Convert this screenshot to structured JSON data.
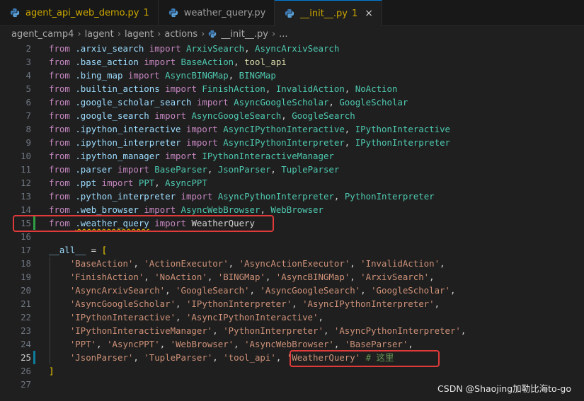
{
  "tabs": [
    {
      "label": "agent_api_web_demo.py",
      "badge": "1",
      "state": "warning"
    },
    {
      "label": "weather_query.py",
      "badge": "",
      "state": "normal"
    },
    {
      "label": "__init__.py",
      "badge": "1",
      "state": "active",
      "close": "×"
    }
  ],
  "breadcrumb": [
    "agent_camp4",
    "lagent",
    "lagent",
    "actions",
    "__init__.py",
    "..."
  ],
  "current_line": 25,
  "lines": [
    {
      "n": "2",
      "t": [
        [
          "kw",
          "from"
        ],
        [
          "pun",
          " "
        ],
        [
          "mod",
          ".arxiv_search"
        ],
        [
          "pun",
          " "
        ],
        [
          "kw",
          "import"
        ],
        [
          "pun",
          " "
        ],
        [
          "cls",
          "ArxivSearch"
        ],
        [
          "pun",
          ", "
        ],
        [
          "cls",
          "AsyncArxivSearch"
        ]
      ]
    },
    {
      "n": "3",
      "t": [
        [
          "kw",
          "from"
        ],
        [
          "pun",
          " "
        ],
        [
          "mod",
          ".base_action"
        ],
        [
          "pun",
          " "
        ],
        [
          "kw",
          "import"
        ],
        [
          "pun",
          " "
        ],
        [
          "cls",
          "BaseAction"
        ],
        [
          "pun",
          ", "
        ],
        [
          "fn",
          "tool_api"
        ]
      ]
    },
    {
      "n": "4",
      "t": [
        [
          "kw",
          "from"
        ],
        [
          "pun",
          " "
        ],
        [
          "mod",
          ".bing_map"
        ],
        [
          "pun",
          " "
        ],
        [
          "kw",
          "import"
        ],
        [
          "pun",
          " "
        ],
        [
          "cls",
          "AsyncBINGMap"
        ],
        [
          "pun",
          ", "
        ],
        [
          "cls",
          "BINGMap"
        ]
      ]
    },
    {
      "n": "5",
      "t": [
        [
          "kw",
          "from"
        ],
        [
          "pun",
          " "
        ],
        [
          "mod",
          ".builtin_actions"
        ],
        [
          "pun",
          " "
        ],
        [
          "kw",
          "import"
        ],
        [
          "pun",
          " "
        ],
        [
          "cls",
          "FinishAction"
        ],
        [
          "pun",
          ", "
        ],
        [
          "cls",
          "InvalidAction"
        ],
        [
          "pun",
          ", "
        ],
        [
          "cls",
          "NoAction"
        ]
      ]
    },
    {
      "n": "6",
      "t": [
        [
          "kw",
          "from"
        ],
        [
          "pun",
          " "
        ],
        [
          "mod",
          ".google_scholar_search"
        ],
        [
          "pun",
          " "
        ],
        [
          "kw",
          "import"
        ],
        [
          "pun",
          " "
        ],
        [
          "cls",
          "AsyncGoogleScholar"
        ],
        [
          "pun",
          ", "
        ],
        [
          "cls",
          "GoogleScholar"
        ]
      ]
    },
    {
      "n": "7",
      "t": [
        [
          "kw",
          "from"
        ],
        [
          "pun",
          " "
        ],
        [
          "mod",
          ".google_search"
        ],
        [
          "pun",
          " "
        ],
        [
          "kw",
          "import"
        ],
        [
          "pun",
          " "
        ],
        [
          "cls",
          "AsyncGoogleSearch"
        ],
        [
          "pun",
          ", "
        ],
        [
          "cls",
          "GoogleSearch"
        ]
      ]
    },
    {
      "n": "8",
      "t": [
        [
          "kw",
          "from"
        ],
        [
          "pun",
          " "
        ],
        [
          "mod",
          ".ipython_interactive"
        ],
        [
          "pun",
          " "
        ],
        [
          "kw",
          "import"
        ],
        [
          "pun",
          " "
        ],
        [
          "cls",
          "AsyncIPythonInteractive"
        ],
        [
          "pun",
          ", "
        ],
        [
          "cls",
          "IPythonInteractive"
        ]
      ]
    },
    {
      "n": "9",
      "t": [
        [
          "kw",
          "from"
        ],
        [
          "pun",
          " "
        ],
        [
          "mod",
          ".ipython_interpreter"
        ],
        [
          "pun",
          " "
        ],
        [
          "kw",
          "import"
        ],
        [
          "pun",
          " "
        ],
        [
          "cls",
          "AsyncIPythonInterpreter"
        ],
        [
          "pun",
          ", "
        ],
        [
          "cls",
          "IPythonInterpreter"
        ]
      ]
    },
    {
      "n": "10",
      "t": [
        [
          "kw",
          "from"
        ],
        [
          "pun",
          " "
        ],
        [
          "mod",
          ".ipython_manager"
        ],
        [
          "pun",
          " "
        ],
        [
          "kw",
          "import"
        ],
        [
          "pun",
          " "
        ],
        [
          "cls",
          "IPythonInteractiveManager"
        ]
      ]
    },
    {
      "n": "11",
      "t": [
        [
          "kw",
          "from"
        ],
        [
          "pun",
          " "
        ],
        [
          "mod",
          ".parser"
        ],
        [
          "pun",
          " "
        ],
        [
          "kw",
          "import"
        ],
        [
          "pun",
          " "
        ],
        [
          "cls",
          "BaseParser"
        ],
        [
          "pun",
          ", "
        ],
        [
          "cls",
          "JsonParser"
        ],
        [
          "pun",
          ", "
        ],
        [
          "cls",
          "TupleParser"
        ]
      ]
    },
    {
      "n": "12",
      "t": [
        [
          "kw",
          "from"
        ],
        [
          "pun",
          " "
        ],
        [
          "mod",
          ".ppt"
        ],
        [
          "pun",
          " "
        ],
        [
          "kw",
          "import"
        ],
        [
          "pun",
          " "
        ],
        [
          "cls",
          "PPT"
        ],
        [
          "pun",
          ", "
        ],
        [
          "cls",
          "AsyncPPT"
        ]
      ]
    },
    {
      "n": "13",
      "t": [
        [
          "kw",
          "from"
        ],
        [
          "pun",
          " "
        ],
        [
          "mod",
          ".python_interpreter"
        ],
        [
          "pun",
          " "
        ],
        [
          "kw",
          "import"
        ],
        [
          "pun",
          " "
        ],
        [
          "cls",
          "AsyncPythonInterpreter"
        ],
        [
          "pun",
          ", "
        ],
        [
          "cls",
          "PythonInterpreter"
        ]
      ]
    },
    {
      "n": "14",
      "t": [
        [
          "kw",
          "from"
        ],
        [
          "pun",
          " "
        ],
        [
          "mod",
          ".web_browser"
        ],
        [
          "pun",
          " "
        ],
        [
          "kw",
          "import"
        ],
        [
          "pun",
          " "
        ],
        [
          "cls",
          "AsyncWebBrowser"
        ],
        [
          "pun",
          ", "
        ],
        [
          "cls",
          "WebBrowser"
        ]
      ]
    },
    {
      "n": "15",
      "t": [
        [
          "kw",
          "from"
        ],
        [
          "pun",
          " "
        ],
        [
          "mod sq",
          ".weather_query"
        ],
        [
          "pun",
          " "
        ],
        [
          "kw",
          "import"
        ],
        [
          "pun",
          " "
        ],
        [
          "pun",
          "WeatherQuery"
        ]
      ]
    },
    {
      "n": "16",
      "t": []
    },
    {
      "n": "17",
      "t": [
        [
          "var",
          "__all__"
        ],
        [
          "pun",
          " = "
        ],
        [
          "br",
          "["
        ]
      ]
    },
    {
      "n": "18",
      "t": [
        [
          "pun",
          "    "
        ],
        [
          "str",
          "'BaseAction'"
        ],
        [
          "pun",
          ", "
        ],
        [
          "str",
          "'ActionExecutor'"
        ],
        [
          "pun",
          ", "
        ],
        [
          "str",
          "'AsyncActionExecutor'"
        ],
        [
          "pun",
          ", "
        ],
        [
          "str",
          "'InvalidAction'"
        ],
        [
          "pun",
          ","
        ]
      ]
    },
    {
      "n": "19",
      "t": [
        [
          "pun",
          "    "
        ],
        [
          "str",
          "'FinishAction'"
        ],
        [
          "pun",
          ", "
        ],
        [
          "str",
          "'NoAction'"
        ],
        [
          "pun",
          ", "
        ],
        [
          "str",
          "'BINGMap'"
        ],
        [
          "pun",
          ", "
        ],
        [
          "str",
          "'AsyncBINGMap'"
        ],
        [
          "pun",
          ", "
        ],
        [
          "str",
          "'ArxivSearch'"
        ],
        [
          "pun",
          ","
        ]
      ]
    },
    {
      "n": "20",
      "t": [
        [
          "pun",
          "    "
        ],
        [
          "str",
          "'AsyncArxivSearch'"
        ],
        [
          "pun",
          ", "
        ],
        [
          "str",
          "'GoogleSearch'"
        ],
        [
          "pun",
          ", "
        ],
        [
          "str",
          "'AsyncGoogleSearch'"
        ],
        [
          "pun",
          ", "
        ],
        [
          "str",
          "'GoogleScholar'"
        ],
        [
          "pun",
          ","
        ]
      ]
    },
    {
      "n": "21",
      "t": [
        [
          "pun",
          "    "
        ],
        [
          "str",
          "'AsyncGoogleScholar'"
        ],
        [
          "pun",
          ", "
        ],
        [
          "str",
          "'IPythonInterpreter'"
        ],
        [
          "pun",
          ", "
        ],
        [
          "str",
          "'AsyncIPythonInterpreter'"
        ],
        [
          "pun",
          ","
        ]
      ]
    },
    {
      "n": "22",
      "t": [
        [
          "pun",
          "    "
        ],
        [
          "str",
          "'IPythonInteractive'"
        ],
        [
          "pun",
          ", "
        ],
        [
          "str",
          "'AsyncIPythonInteractive'"
        ],
        [
          "pun",
          ","
        ]
      ]
    },
    {
      "n": "23",
      "t": [
        [
          "pun",
          "    "
        ],
        [
          "str",
          "'IPythonInteractiveManager'"
        ],
        [
          "pun",
          ", "
        ],
        [
          "str",
          "'PythonInterpreter'"
        ],
        [
          "pun",
          ", "
        ],
        [
          "str",
          "'AsyncPythonInterpreter'"
        ],
        [
          "pun",
          ","
        ]
      ]
    },
    {
      "n": "24",
      "t": [
        [
          "pun",
          "    "
        ],
        [
          "str",
          "'PPT'"
        ],
        [
          "pun",
          ", "
        ],
        [
          "str",
          "'AsyncPPT'"
        ],
        [
          "pun",
          ", "
        ],
        [
          "str",
          "'WebBrowser'"
        ],
        [
          "pun",
          ", "
        ],
        [
          "str",
          "'AsyncWebBrowser'"
        ],
        [
          "pun",
          ", "
        ],
        [
          "str",
          "'BaseParser'"
        ],
        [
          "pun",
          ","
        ]
      ]
    },
    {
      "n": "25",
      "t": [
        [
          "pun",
          "    "
        ],
        [
          "str",
          "'JsonParser'"
        ],
        [
          "pun",
          ", "
        ],
        [
          "str",
          "'TupleParser'"
        ],
        [
          "pun",
          ", "
        ],
        [
          "str",
          "'tool_api'"
        ],
        [
          "pun",
          ", "
        ],
        [
          "str",
          "'WeatherQuery'"
        ],
        [
          "pun",
          " "
        ],
        [
          "cm",
          "# 这里"
        ]
      ]
    },
    {
      "n": "26",
      "t": [
        [
          "br",
          "]"
        ]
      ]
    },
    {
      "n": "27",
      "t": []
    }
  ],
  "watermark": "CSDN @Shaojing加勒比海to-go",
  "colors": {
    "highlight_box": "#e03a3a",
    "keyword": "#c586c0",
    "class": "#4ec9b0",
    "string": "#ce9178",
    "comment": "#6a9955"
  }
}
